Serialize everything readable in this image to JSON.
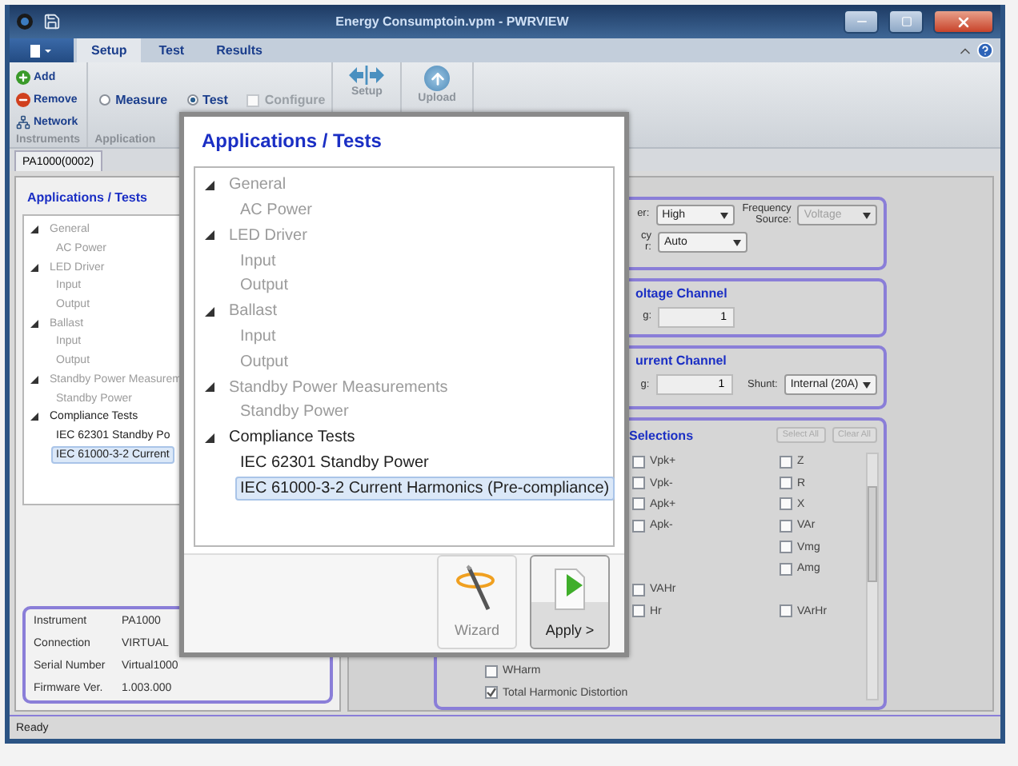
{
  "window": {
    "title": "Energy Consumptoin.vpm - PWRVIEW"
  },
  "ribbon_tabs": [
    {
      "label": "Setup",
      "selected": true
    },
    {
      "label": "Test",
      "selected": false
    },
    {
      "label": "Results",
      "selected": false
    }
  ],
  "ribbon": {
    "instruments": {
      "buttons": [
        {
          "label": "Add",
          "kind": "add"
        },
        {
          "label": "Remove",
          "kind": "remove"
        },
        {
          "label": "Network",
          "kind": "network"
        }
      ],
      "group_label": "Instruments"
    },
    "application": {
      "modes": [
        {
          "label": "Measure",
          "selected": false
        },
        {
          "label": "Test",
          "selected": true
        }
      ],
      "configure": {
        "label": "Configure",
        "checked": false,
        "disabled": true
      },
      "group_label": "Application"
    },
    "actions": [
      {
        "label": "Setup",
        "kind": "setup"
      },
      {
        "label": "Upload",
        "kind": "upload"
      }
    ]
  },
  "document_tab": "PA1000(0002)",
  "left_panel": {
    "title": "Applications / Tests",
    "tree": [
      {
        "label": "General",
        "expanded": true,
        "disabled": true,
        "children": [
          {
            "label": "AC Power",
            "selected": false,
            "disabled": true
          }
        ]
      },
      {
        "label": "LED Driver",
        "expanded": true,
        "disabled": true,
        "children": [
          {
            "label": "Input",
            "selected": false,
            "disabled": true
          },
          {
            "label": "Output",
            "selected": false,
            "disabled": true
          }
        ]
      },
      {
        "label": "Ballast",
        "expanded": true,
        "disabled": true,
        "children": [
          {
            "label": "Input",
            "selected": false,
            "disabled": true
          },
          {
            "label": "Output",
            "selected": false,
            "disabled": true
          }
        ]
      },
      {
        "label": "Standby Power Measurem",
        "expanded": true,
        "disabled": true,
        "children": [
          {
            "label": "Standby Power",
            "selected": false,
            "disabled": true
          }
        ]
      },
      {
        "label": "Compliance Tests",
        "expanded": true,
        "disabled": false,
        "children": [
          {
            "label": "IEC 62301 Standby Po",
            "selected": false,
            "disabled": false
          },
          {
            "label": "IEC 61000-3-2 Current",
            "selected": true,
            "disabled": false
          }
        ]
      }
    ],
    "info": [
      {
        "label": "Instrument",
        "value": "PA1000"
      },
      {
        "label": "Connection",
        "value": "VIRTUAL"
      },
      {
        "label": "Serial Number",
        "value": "Virtual1000"
      },
      {
        "label": "Firmware Ver.",
        "value": "1.003.000"
      }
    ]
  },
  "right_panel": {
    "settings": {
      "rows": [
        [
          {
            "label": "er:",
            "value": "High",
            "disabled": false
          },
          {
            "label": "Frequency Source:",
            "value": "Voltage",
            "disabled": true
          }
        ],
        [
          {
            "label": "cy r:",
            "value": "Auto",
            "disabled": false
          }
        ]
      ]
    },
    "voltage_channel": {
      "title": "oltage Channel",
      "fields": [
        {
          "label": "g:",
          "value": "1"
        }
      ]
    },
    "current_channel": {
      "title": "urrent Channel",
      "fields": [
        {
          "label": "g:",
          "value": "1"
        }
      ],
      "shunt": {
        "label": "Shunt:",
        "value": "Internal (20A)"
      }
    },
    "selections": {
      "title": "Selections",
      "buttons": [
        "Select All",
        "Clear All"
      ],
      "rows": [
        {
          "middle": {
            "label": "Vpk+",
            "checked": false
          },
          "right": {
            "label": "Z",
            "checked": false
          }
        },
        {
          "middle": {
            "label": "Vpk-",
            "checked": false
          },
          "right": {
            "label": "R",
            "checked": false
          }
        },
        {
          "middle": {
            "label": "Apk+",
            "checked": false
          },
          "right": {
            "label": "X",
            "checked": false
          }
        },
        {
          "middle": {
            "label": "Apk-",
            "checked": false
          },
          "right": {
            "label": "VAr",
            "checked": false
          }
        },
        {
          "right": {
            "label": "Vmg",
            "checked": false
          }
        },
        {
          "right": {
            "label": "Amg",
            "checked": false
          }
        },
        {
          "middle": {
            "label": "VAHr",
            "checked": false
          }
        },
        {
          "middle": {
            "label": "Hr",
            "checked": false
          },
          "right": {
            "label": "VArHr",
            "checked": false
          }
        }
      ],
      "bottom": [
        {
          "label": "WHarm",
          "checked": false
        },
        {
          "label": "Total Harmonic Distortion",
          "checked": true
        }
      ]
    }
  },
  "dialog": {
    "title": "Applications / Tests",
    "tree": [
      {
        "label": "General",
        "expanded": true,
        "disabled": true,
        "children": [
          {
            "label": "AC Power",
            "selected": false,
            "disabled": true
          }
        ]
      },
      {
        "label": "LED Driver",
        "expanded": true,
        "disabled": true,
        "children": [
          {
            "label": "Input",
            "selected": false,
            "disabled": true
          },
          {
            "label": "Output",
            "selected": false,
            "disabled": true
          }
        ]
      },
      {
        "label": "Ballast",
        "expanded": true,
        "disabled": true,
        "children": [
          {
            "label": "Input",
            "selected": false,
            "disabled": true
          },
          {
            "label": "Output",
            "selected": false,
            "disabled": true
          }
        ]
      },
      {
        "label": "Standby Power Measurements",
        "expanded": true,
        "disabled": true,
        "children": [
          {
            "label": "Standby Power",
            "selected": false,
            "disabled": true
          }
        ]
      },
      {
        "label": "Compliance Tests",
        "expanded": true,
        "disabled": false,
        "children": [
          {
            "label": "IEC 62301 Standby Power",
            "selected": false,
            "disabled": false
          },
          {
            "label": "IEC 61000-3-2 Current Harmonics (Pre-compliance)",
            "selected": true,
            "disabled": false
          }
        ]
      }
    ],
    "buttons": [
      {
        "label": "Wizard",
        "kind": "wizard",
        "disabled": true
      },
      {
        "label": "Apply >",
        "kind": "apply",
        "disabled": false
      }
    ]
  },
  "status_bar": "Ready"
}
